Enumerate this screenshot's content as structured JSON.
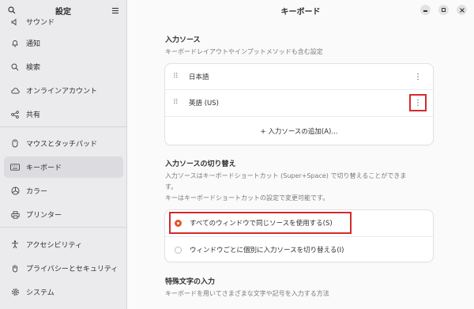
{
  "sidebar": {
    "title": "設定",
    "items": [
      {
        "label": "サウンド",
        "icon": "sound-icon"
      },
      {
        "label": "通知",
        "icon": "bell-icon"
      },
      {
        "label": "検索",
        "icon": "search-icon"
      },
      {
        "label": "オンラインアカウント",
        "icon": "cloud-icon"
      },
      {
        "label": "共有",
        "icon": "share-icon"
      },
      {
        "label": "マウスとタッチパッド",
        "icon": "mouse-icon"
      },
      {
        "label": "キーボード",
        "icon": "keyboard-icon",
        "active": true
      },
      {
        "label": "カラー",
        "icon": "color-icon"
      },
      {
        "label": "プリンター",
        "icon": "printer-icon"
      },
      {
        "label": "アクセシビリティ",
        "icon": "accessibility-icon"
      },
      {
        "label": "プライバシーとセキュリティ",
        "icon": "hand-icon"
      },
      {
        "label": "システム",
        "icon": "system-icon"
      }
    ]
  },
  "main": {
    "title": "キーボード",
    "input_sources": {
      "title": "入力ソース",
      "description": "キーボードレイアウトやインプットメソッドも含む設定",
      "sources": [
        "日本語",
        "英語 (US)"
      ],
      "add_label": "+ 入力ソースの追加(A)..."
    },
    "switching": {
      "title": "入力ソースの切り替え",
      "description_line1": "入力ソースはキーボードショートカット (Super+Space) で切り替えることができま",
      "description_line2": "す。",
      "description_line3": "キーはキーボードショートカットの設定で変更可能です。",
      "options": [
        {
          "label": "すべてのウィンドウで同じソースを使用する(S)",
          "selected": true
        },
        {
          "label": "ウィンドウごとに個別に入力ソースを切り替える(I)",
          "selected": false
        }
      ]
    },
    "special_chars": {
      "title": "特殊文字の入力",
      "description": "キーボードを用いてさまざまな文字や記号を入力する方法"
    }
  },
  "colors": {
    "accent": "#e55227",
    "highlight": "#d42a2a"
  }
}
